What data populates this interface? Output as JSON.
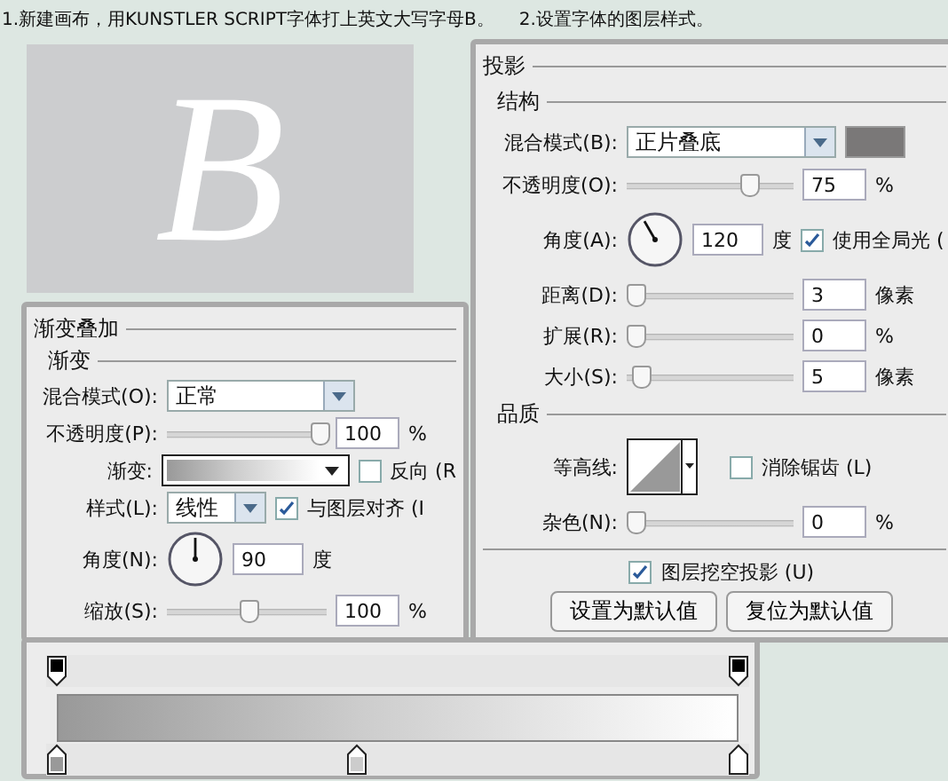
{
  "captions": [
    "1.新建画布，用KUNSTLER SCRIPT字体打上英文大写字母B。",
    "2.设置字体的图层样式。"
  ],
  "canvas": {
    "letter": "B"
  },
  "drop_shadow": {
    "title": "投影",
    "section": "结构",
    "blend": {
      "label": "混合模式(B):",
      "value": "正片叠底",
      "color": "#7a7878"
    },
    "opacity": {
      "label": "不透明度(O):",
      "level": 0.75,
      "value": "75",
      "unit": "%"
    },
    "angle": {
      "label": "角度(A):",
      "value": "120",
      "unit": "度"
    },
    "global_light": {
      "label": "使用全局光 (",
      "checked": true
    },
    "sliders": [
      {
        "label": "距离(D):",
        "level": 0,
        "value": "3",
        "unit": "像素"
      },
      {
        "label": "扩展(R):",
        "level": 0,
        "value": "0",
        "unit": "%"
      },
      {
        "label": "大小(S):",
        "level": 0.04,
        "value": "5",
        "unit": "像素"
      }
    ],
    "quality": "品质",
    "contour": {
      "label": "等高线:"
    },
    "antialias": {
      "label": "消除锯齿 (L)",
      "checked": false
    },
    "noise": {
      "label": "杂色(N):",
      "level": 0,
      "value": "0",
      "unit": "%"
    },
    "knockout": {
      "label": "图层挖空投影 (U)",
      "checked": true
    },
    "buttons": [
      "设置为默认值",
      "复位为默认值"
    ]
  },
  "gradient_overlay": {
    "title": "渐变叠加",
    "section": "渐变",
    "blend": {
      "label": "混合模式(O):",
      "value": "正常"
    },
    "opacity": {
      "label": "不透明度(P):",
      "level": 1,
      "value": "100",
      "unit": "%"
    },
    "gradient": {
      "label": "渐变:"
    },
    "reverse": {
      "label": "反向 (R",
      "checked": false
    },
    "style": {
      "label": "样式(L):",
      "value": "线性"
    },
    "align": {
      "label": "与图层对齐 (I",
      "checked": true
    },
    "angle": {
      "label": "角度(N):",
      "value": "90",
      "unit": "度"
    },
    "scale": {
      "label": "缩放(S):",
      "level": 0.5,
      "value": "100",
      "unit": "%"
    }
  },
  "gradient_editor": {
    "opacity_stops": [
      {
        "level": 0
      },
      {
        "level": 1
      }
    ],
    "color_stops": [
      {
        "level": 0,
        "color": "#999999"
      },
      {
        "level": 0.44,
        "color": "#cccccc"
      },
      {
        "level": 1,
        "color": "#ffffff"
      }
    ]
  }
}
